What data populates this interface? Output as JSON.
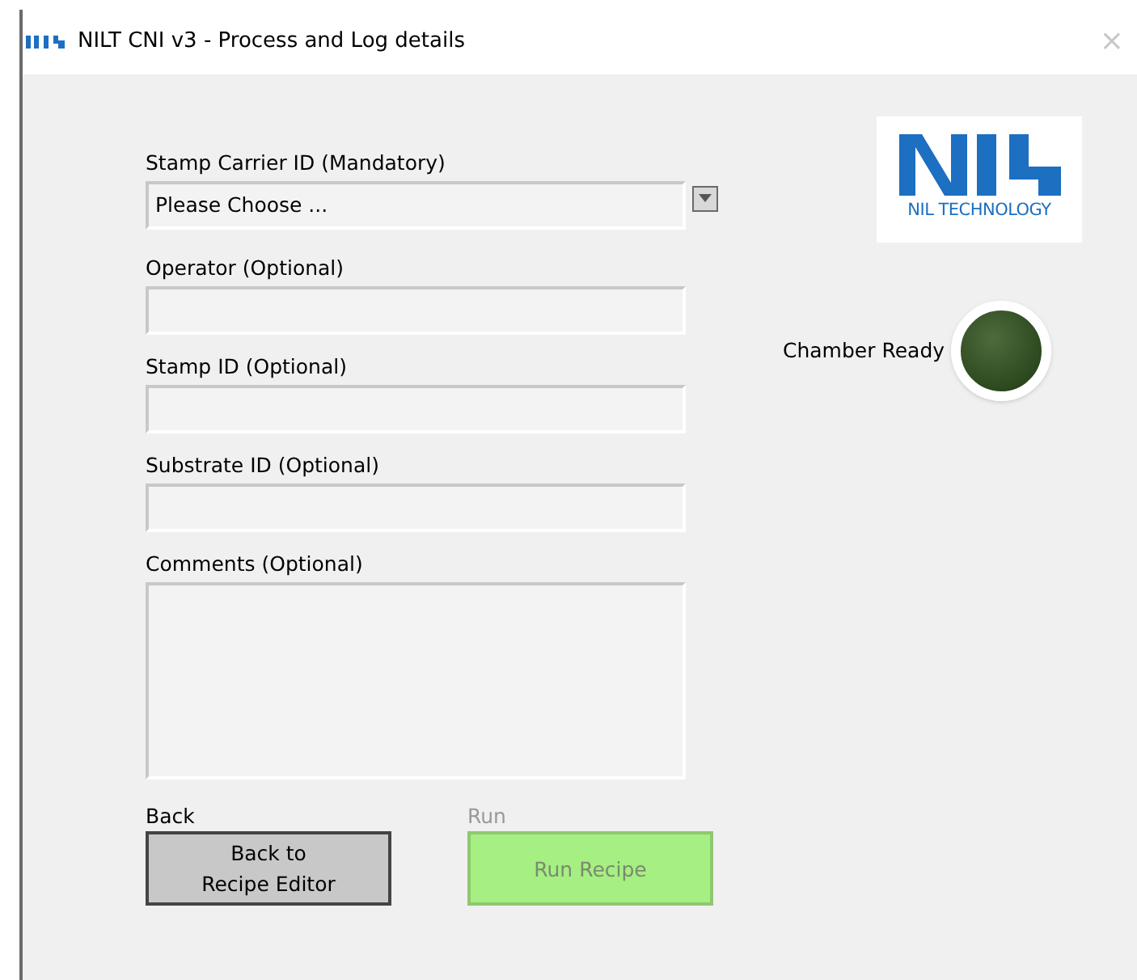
{
  "window": {
    "title": "NILT CNI v3 - Process and Log details",
    "close": "×"
  },
  "form": {
    "fields": [
      {
        "kind": "dropdown",
        "label": "Stamp Carrier ID (Mandatory)",
        "value": "Please Choose ..."
      },
      {
        "kind": "text",
        "label": "Operator (Optional)"
      },
      {
        "kind": "text",
        "label": "Stamp ID (Optional)"
      },
      {
        "kind": "text",
        "label": "Substrate ID (Optional)"
      },
      {
        "kind": "textarea",
        "label": "Comments (Optional)"
      }
    ]
  },
  "logo": {
    "text": "NIL TECHNOLOGY"
  },
  "indicator": {
    "label": "Chamber Ready",
    "on": false
  },
  "buttons": [
    {
      "kind": "back",
      "label": "Back",
      "text": "Back to\nRecipe Editor",
      "disabled": false
    },
    {
      "kind": "run",
      "label": "Run",
      "text": "Run Recipe",
      "disabled": true
    }
  ]
}
